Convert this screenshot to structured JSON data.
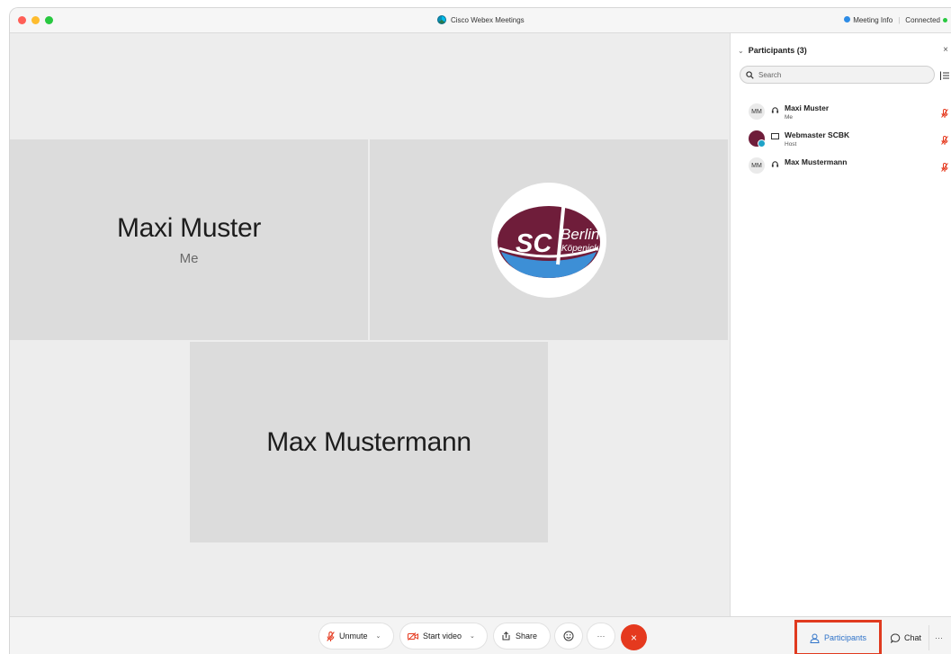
{
  "window": {
    "title": "Cisco Webex Meetings",
    "meeting_info": "Meeting Info",
    "status": "Connected"
  },
  "tiles": [
    {
      "name": "Maxi Muster",
      "subtitle": "Me"
    },
    {
      "name": "",
      "subtitle": ""
    },
    {
      "name": "Max Mustermann",
      "subtitle": ""
    }
  ],
  "participants_panel": {
    "title": "Participants (3)",
    "search_placeholder": "Search",
    "items": [
      {
        "initials": "MM",
        "name": "Maxi Muster",
        "role": "Me"
      },
      {
        "initials": "",
        "name": "Webmaster SCBK",
        "role": "Host"
      },
      {
        "initials": "MM",
        "name": "Max Mustermann",
        "role": ""
      }
    ]
  },
  "toolbar": {
    "unmute": "Unmute",
    "start_video": "Start video",
    "share": "Share",
    "participants": "Participants",
    "chat": "Chat"
  },
  "logo": {
    "text_sc": "SC",
    "text_city": "Berlin",
    "text_district": "Köpenick"
  },
  "colors": {
    "accent": "#2f73c9",
    "end_call": "#e5391e",
    "highlight": "#e03a1f",
    "mute": "#e5391e",
    "logo_maroon": "#6f1d3a",
    "logo_blue": "#3d8fd6"
  }
}
